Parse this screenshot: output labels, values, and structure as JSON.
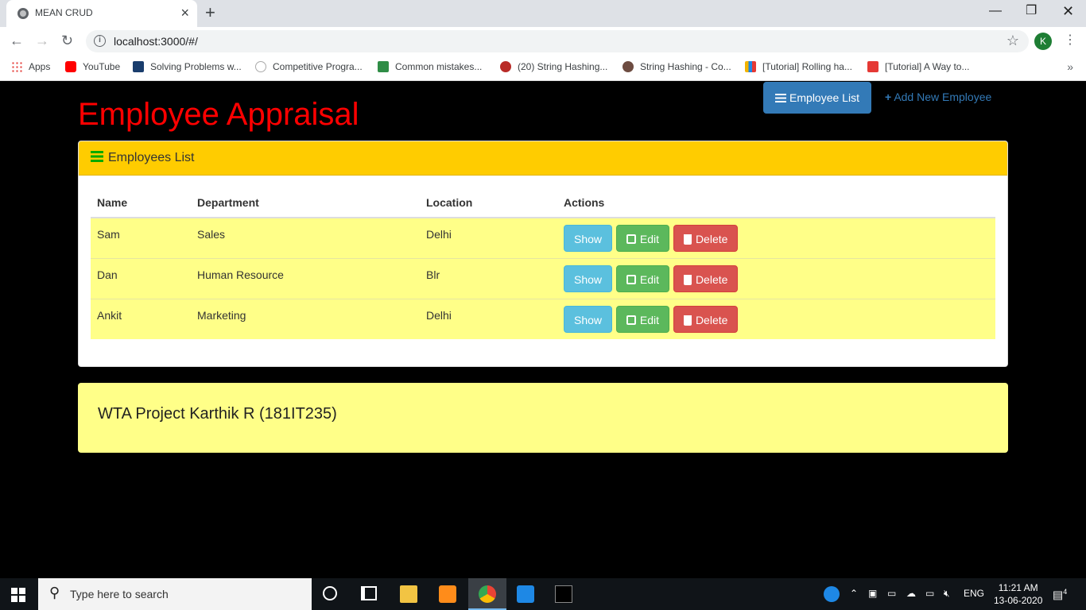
{
  "browser": {
    "tab_title": "MEAN CRUD",
    "url": "localhost:3000/#/",
    "profile_initial": "K",
    "bookmarks": [
      {
        "label": "Apps"
      },
      {
        "label": "YouTube"
      },
      {
        "label": "Solving Problems w..."
      },
      {
        "label": "Competitive Progra..."
      },
      {
        "label": "Common mistakes..."
      },
      {
        "label": "(20) String Hashing..."
      },
      {
        "label": "String Hashing - Co..."
      },
      {
        "label": "[Tutorial] Rolling ha..."
      },
      {
        "label": "[Tutorial] A Way to..."
      }
    ]
  },
  "app": {
    "title": "Employee Appraisal",
    "nav": {
      "employee_list": "Employee List",
      "add_new": "Add New Employee"
    },
    "panel_title": "Employees List",
    "table": {
      "headers": [
        "Name",
        "Department",
        "Location",
        "Actions"
      ],
      "rows": [
        {
          "name": "Sam",
          "department": "Sales",
          "location": "Delhi"
        },
        {
          "name": "Dan",
          "department": "Human Resource",
          "location": "Blr"
        },
        {
          "name": "Ankit",
          "department": "Marketing",
          "location": "Delhi"
        }
      ],
      "actions": {
        "show": "Show",
        "edit": "Edit",
        "delete": "Delete"
      }
    },
    "footer": "WTA Project Karthik R (181IT235)"
  },
  "taskbar": {
    "search_placeholder": "Type here to search",
    "language": "ENG",
    "time": "11:21 AM",
    "date": "13-06-2020",
    "notification_count": "4"
  },
  "colors": {
    "title_red": "#ff0000",
    "panel_heading": "#ffcc00",
    "row_yellow": "#ffff88",
    "primary": "#337ab7",
    "info": "#5bc0de",
    "success": "#5cb85c",
    "danger": "#d9534f"
  }
}
